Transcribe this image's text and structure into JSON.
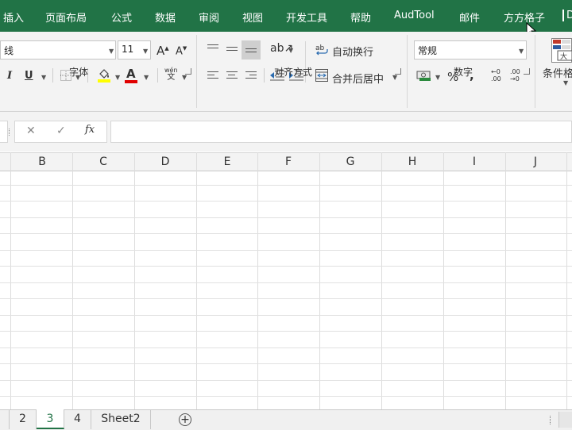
{
  "menu": {
    "items": [
      "插入",
      "页面布局",
      "公式",
      "数据",
      "审阅",
      "视图",
      "开发工具",
      "帮助",
      "AudTool",
      "邮件",
      "方方格子",
      "D"
    ]
  },
  "ribbon": {
    "font": {
      "name": "线",
      "size": "11",
      "grow": "A",
      "shrink": "A",
      "italic": "I",
      "underline": "U",
      "font_color": "A",
      "phonetic_top": "wén",
      "phonetic_bottom": "文",
      "label": "字体"
    },
    "alignment": {
      "wrap_text": "自动换行",
      "merge_center": "合并后居中",
      "label": "对齐方式"
    },
    "number": {
      "format": "常规",
      "percent": "%",
      "comma": ",",
      "label": "数字"
    },
    "styles": {
      "conditional_format": "条件格"
    }
  },
  "formula_bar": {
    "cancel": "✕",
    "enter": "✓",
    "fx": "fx",
    "value": ""
  },
  "columns": [
    "B",
    "C",
    "D",
    "E",
    "F",
    "G",
    "H",
    "I",
    "J"
  ],
  "sheet_tabs": {
    "tabs": [
      "2",
      "3",
      "4",
      "Sheet2"
    ],
    "active": "3",
    "add": "+"
  },
  "colors": {
    "brand_green": "#217346",
    "fill_highlight": "#ffff00",
    "font_red": "#e00000"
  }
}
